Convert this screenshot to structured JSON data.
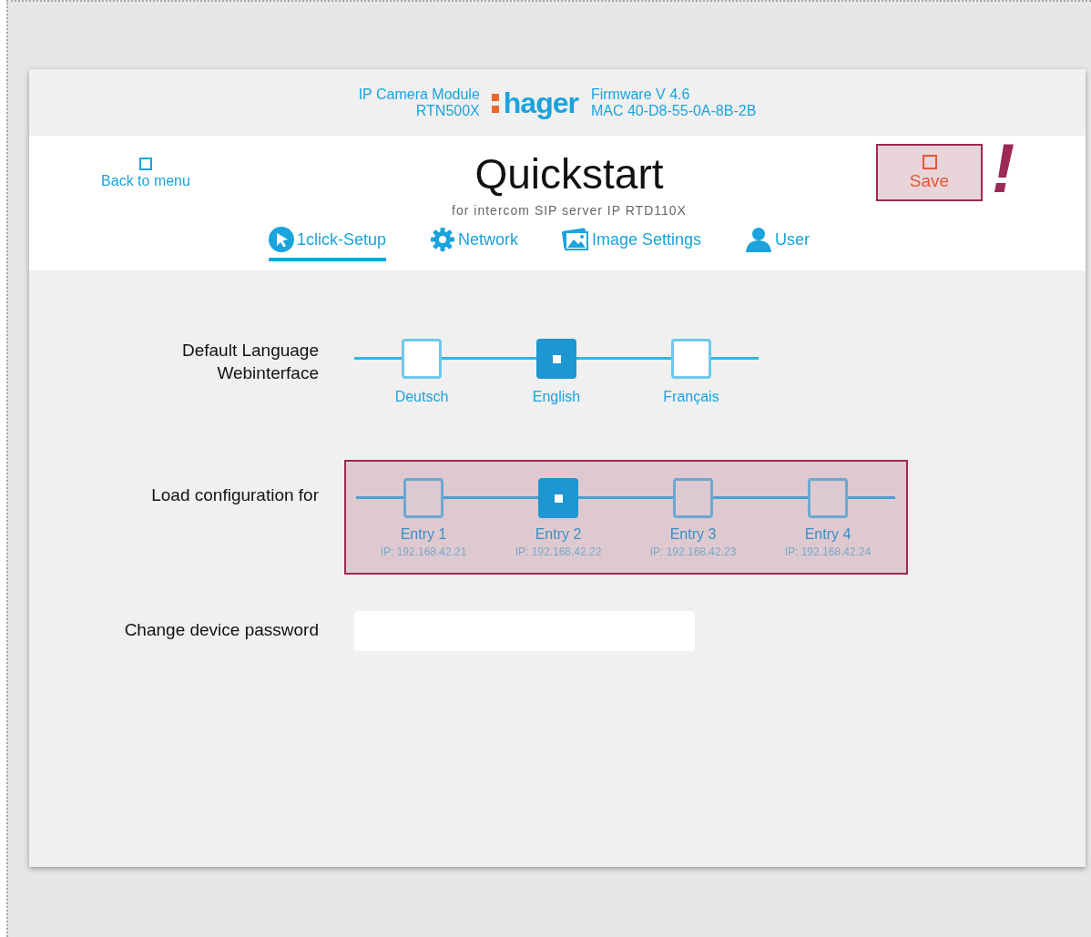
{
  "header": {
    "device_name": "IP Camera Module",
    "device_model": "RTN500X",
    "logo": "hager",
    "firmware": "Firmware V 4.6",
    "mac": "MAC 40-D8-55-0A-8B-2B"
  },
  "back_link": "Back to menu",
  "title": "Quickstart",
  "subtitle": "for intercom SIP server IP RTD110X",
  "save_button": {
    "label": "Save",
    "highlighted": true
  },
  "alert_mark": "!",
  "tabs": [
    {
      "label": "1click-Setup",
      "selected": true
    },
    {
      "label": "Network",
      "selected": false
    },
    {
      "label": "Image Settings",
      "selected": false
    },
    {
      "label": "User",
      "selected": false
    }
  ],
  "language": {
    "label_lines": [
      "Default Language",
      "Webinterface"
    ],
    "options": [
      {
        "label": "Deutsch",
        "selected": false
      },
      {
        "label": "English",
        "selected": true
      },
      {
        "label": "Français",
        "selected": false
      }
    ]
  },
  "load_config": {
    "label": "Load configuration for",
    "highlighted": true,
    "entries": [
      {
        "label": "Entry 1",
        "ip": "IP: 192.168.42.21",
        "selected": false
      },
      {
        "label": "Entry 2",
        "ip": "IP: 192.168.42.22",
        "selected": true
      },
      {
        "label": "Entry 3",
        "ip": "IP: 192.168.42.23",
        "selected": false
      },
      {
        "label": "Entry 4",
        "ip": "IP: 192.168.42.24",
        "selected": false
      }
    ]
  },
  "password": {
    "label": "Change device password"
  }
}
